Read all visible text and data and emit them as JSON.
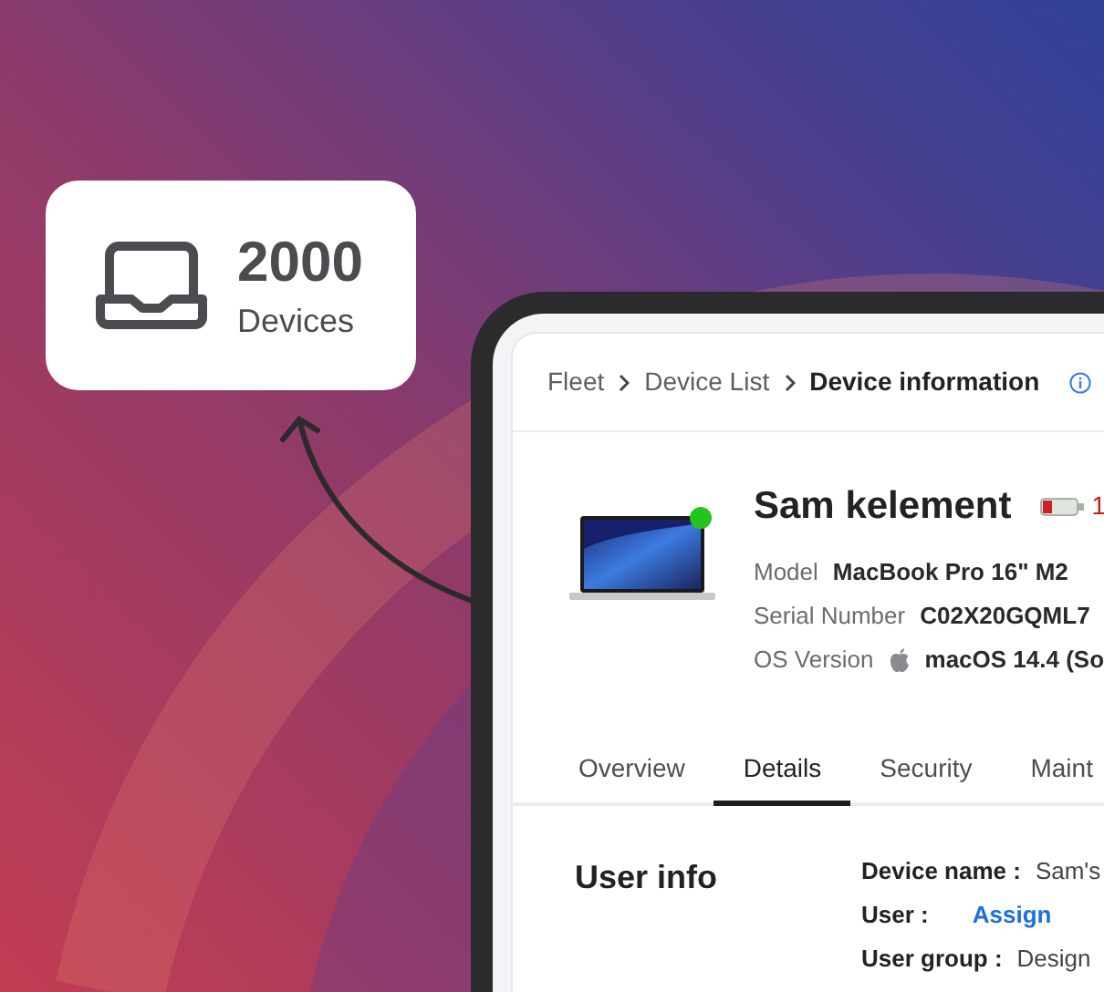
{
  "stat_card": {
    "value": "2000",
    "label": "Devices"
  },
  "device_panel": {
    "breadcrumb": [
      {
        "label": "Fleet",
        "current": false
      },
      {
        "label": "Device List",
        "current": false
      },
      {
        "label": "Device information",
        "current": true
      }
    ],
    "device": {
      "name": "Sam kelement",
      "online": true,
      "battery_reading": "1"
    },
    "properties": [
      {
        "kind": "text",
        "label": "Model",
        "value": "MacBook Pro 16\" M2"
      },
      {
        "kind": "text",
        "label": "Serial Number",
        "value": "C02X20GQML7"
      },
      {
        "kind": "os",
        "label": "OS Version",
        "value": "macOS 14.4 (So"
      }
    ],
    "tabs": [
      {
        "label": "Overview",
        "selected": false
      },
      {
        "label": "Details",
        "selected": true
      },
      {
        "label": "Security",
        "selected": false
      },
      {
        "label": "Maint",
        "selected": false
      }
    ],
    "section": {
      "title": "User info",
      "fields": [
        {
          "kind": "text",
          "label": "Device name :",
          "value": "Sam's"
        },
        {
          "kind": "link",
          "label": "User :",
          "value": "Assign"
        },
        {
          "kind": "text",
          "label": "User group :",
          "value": "Design"
        }
      ]
    }
  }
}
